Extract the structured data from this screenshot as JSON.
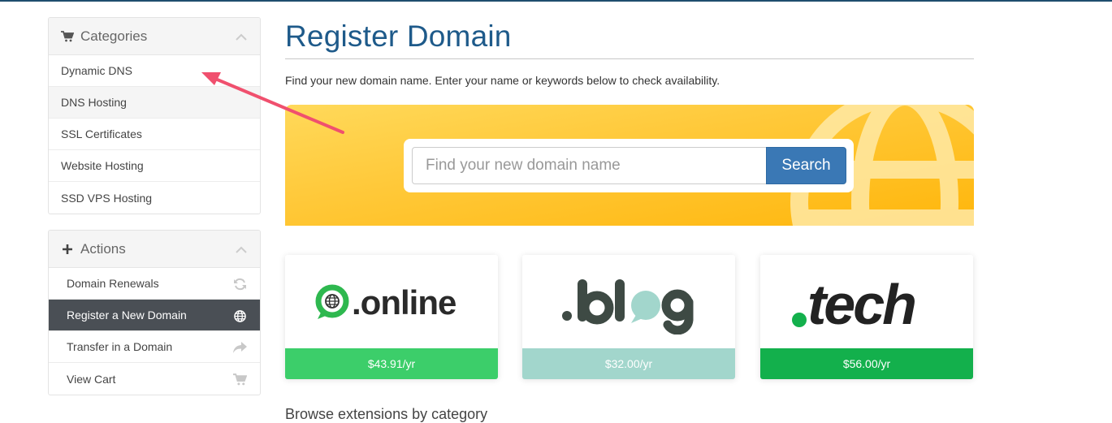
{
  "sidebar": {
    "categories": {
      "title": "Categories",
      "items": [
        {
          "label": "Dynamic DNS"
        },
        {
          "label": "DNS Hosting"
        },
        {
          "label": "SSL Certificates"
        },
        {
          "label": "Website Hosting"
        },
        {
          "label": "SSD VPS Hosting"
        }
      ]
    },
    "actions": {
      "title": "Actions",
      "items": [
        {
          "label": "Domain Renewals",
          "icon": "refresh-icon"
        },
        {
          "label": "Register a New Domain",
          "icon": "globe-icon"
        },
        {
          "label": "Transfer in a Domain",
          "icon": "share-arrow-icon"
        },
        {
          "label": "View Cart",
          "icon": "cart-icon"
        }
      ]
    }
  },
  "main": {
    "title": "Register Domain",
    "intro": "Find your new domain name. Enter your name or keywords below to check availability.",
    "search": {
      "placeholder": "Find your new domain name",
      "value": "",
      "button": "Search"
    },
    "promos": [
      {
        "tld": ".online",
        "price": "$43.91/yr",
        "color": "#3cce6a"
      },
      {
        "tld": ".blog",
        "price": "$32.00/yr",
        "color": "#a2d6cc"
      },
      {
        "tld": ".tech",
        "price": "$56.00/yr",
        "color": "#13b04c"
      }
    ],
    "browse_heading": "Browse extensions by category"
  },
  "colors": {
    "accent": "#1e5a8a",
    "button": "#3a78b5",
    "active_item": "#4a4f55",
    "banner": "#ffc93a",
    "annotation_arrow": "#f0506e"
  }
}
